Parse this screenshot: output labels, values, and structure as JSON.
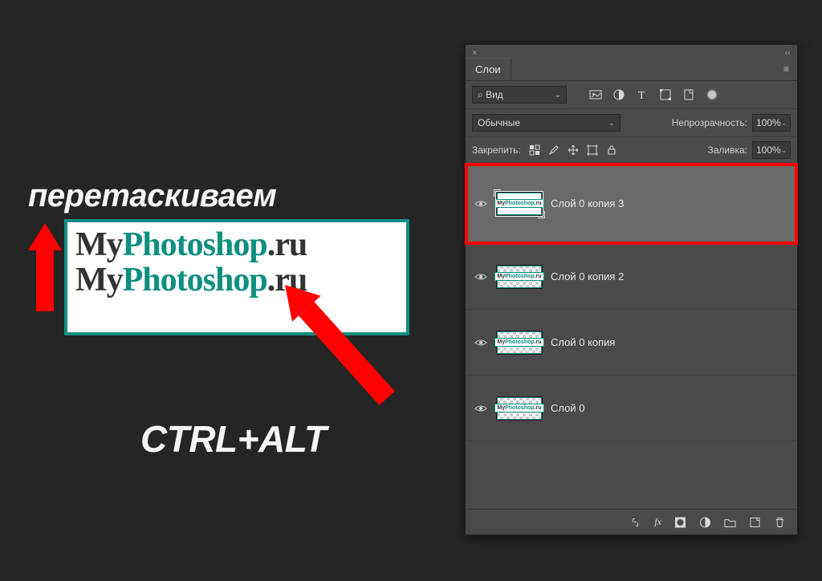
{
  "annotation": {
    "title": "перетаскиваем",
    "shortcut": "CTRL+ALT",
    "logo_prefix": "My",
    "logo_mid": "Photoshop",
    "logo_suffix": ".ru"
  },
  "panel": {
    "tab_label": "Слои",
    "search_label": "Вид",
    "search_icon": "⌕",
    "blend_mode": "Обычные",
    "opacity_label": "Непрозрачность:",
    "opacity_value": "100%",
    "lock_label": "Закрепить:",
    "fill_label": "Заливка:",
    "fill_value": "100%"
  },
  "thumb_text": {
    "p1": "My",
    "p2": "Photoshop",
    "p3": ".ru"
  },
  "layers": [
    {
      "name": "Слой 0 копия 3",
      "selected": true,
      "transparent": false
    },
    {
      "name": "Слой 0 копия 2",
      "selected": false,
      "transparent": true
    },
    {
      "name": "Слой 0 копия",
      "selected": false,
      "transparent": true
    },
    {
      "name": "Слой 0",
      "selected": false,
      "transparent": true
    }
  ]
}
